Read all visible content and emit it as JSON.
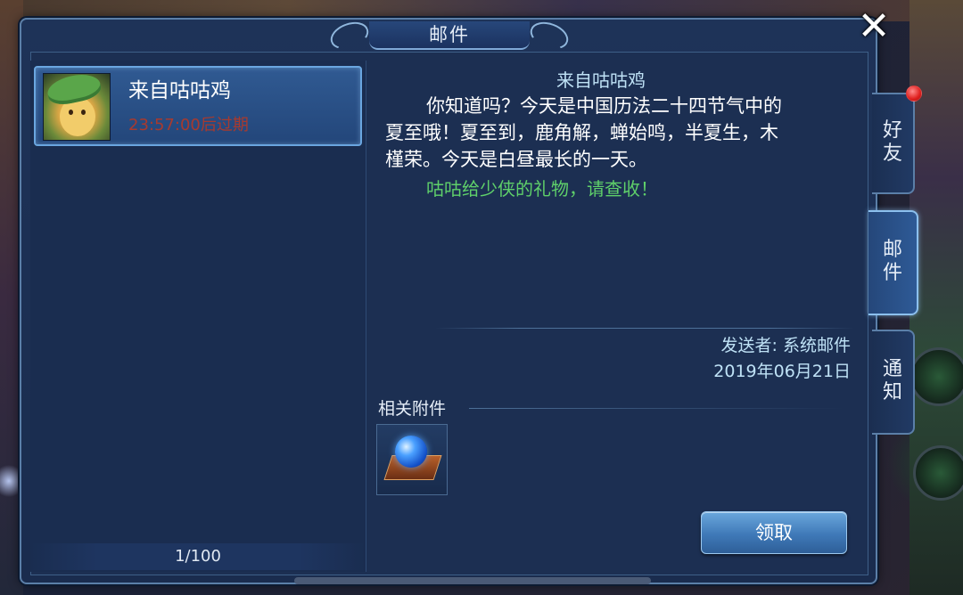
{
  "window": {
    "title": "邮件",
    "close_symbol": "✕"
  },
  "mail_list": {
    "items": [
      {
        "from": "来自咕咕鸡",
        "expire": "23:57:00后过期",
        "avatar_icon": "chick-with-leaf-icon"
      }
    ],
    "page_count": "1/100"
  },
  "mail_detail": {
    "title": "来自咕咕鸡",
    "body_lines": [
      "你知道吗？今天是中国历法二十四节气中的",
      "夏至哦！夏至到，鹿角解，蝉始鸣，半夏生，木",
      "槿荣。今天是白昼最长的一天。"
    ],
    "gift_line": "咕咕给少侠的礼物，请查收！",
    "sender": "发送者: 系统邮件",
    "date": "2019年06月21日",
    "attachment_label": "相关附件",
    "attachment_icon": "blue-orb-on-book-icon",
    "claim_label": "领取"
  },
  "tabs": [
    {
      "line1": "好",
      "line2": "友",
      "badge": true
    },
    {
      "line1": "邮",
      "line2": "件",
      "active": true
    },
    {
      "line1": "通",
      "line2": "知"
    }
  ],
  "colors": {
    "gift_text": "#5fd06a",
    "expire_text": "#a83a2e",
    "title_text": "#bfe2f6",
    "accent": "#6aa6e0"
  }
}
